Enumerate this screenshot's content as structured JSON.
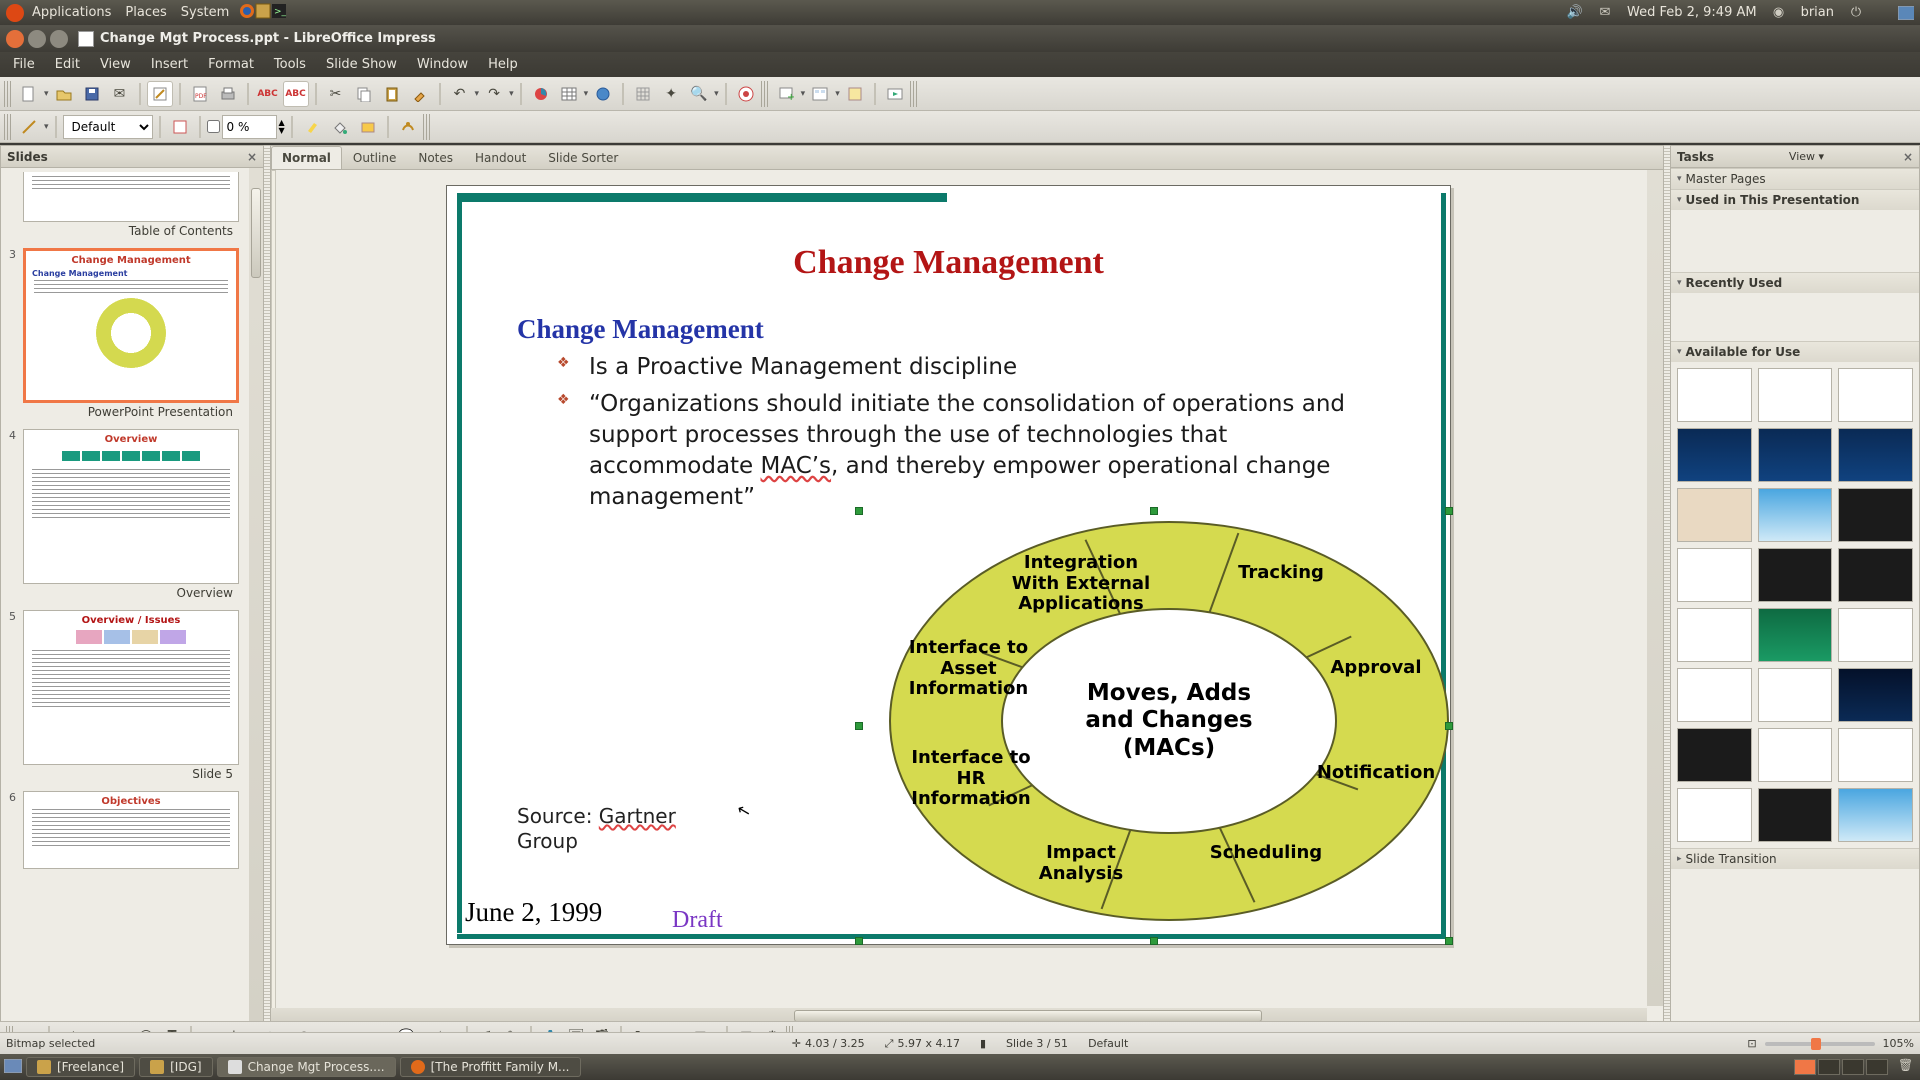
{
  "gnome": {
    "menus": [
      "Applications",
      "Places",
      "System"
    ],
    "datetime": "Wed Feb  2,  9:49 AM",
    "user": "brian"
  },
  "window": {
    "title": "Change Mgt Process.ppt - LibreOffice Impress"
  },
  "menubar": [
    "File",
    "Edit",
    "View",
    "Insert",
    "Format",
    "Tools",
    "Slide Show",
    "Window",
    "Help"
  ],
  "tb2": {
    "style": "Default",
    "pct": "0 %"
  },
  "slides_panel": {
    "title": "Slides"
  },
  "thumbs": [
    {
      "num": "",
      "cap": "Table of Contents",
      "half": true
    },
    {
      "num": "3",
      "cap": "PowerPoint Presentation",
      "sel": true,
      "type": "cm"
    },
    {
      "num": "4",
      "cap": "Overview",
      "type": "ov"
    },
    {
      "num": "5",
      "cap": "Slide 5",
      "type": "s5"
    },
    {
      "num": "6",
      "cap": "",
      "type": "obj",
      "half2": true
    }
  ],
  "viewtabs": [
    "Normal",
    "Outline",
    "Notes",
    "Handout",
    "Slide Sorter"
  ],
  "slide": {
    "title": "Change Management",
    "heading": "Change Management",
    "b1": "Is a Proactive Management discipline",
    "b2a": "“Organizations should initiate the consolidation of operations and support processes through the use of technologies that accommodate ",
    "b2mac": "MAC’s",
    "b2b": ", and thereby empower operational change management”",
    "sourceA": "Source: ",
    "sourceB": "Gartner",
    "sourceC": "Group",
    "date": "June 2, 1999",
    "draft": "Draft",
    "center1": "Moves, Adds",
    "center2": "and Changes",
    "center3": "(MACs)",
    "segs": [
      "Integration With External Applications",
      "Tracking",
      "Approval",
      "Notification",
      "Scheduling",
      "Impact Analysis",
      "Interface to HR Information",
      "Interface to Asset Information"
    ]
  },
  "tasks": {
    "title": "Tasks",
    "view": "View",
    "s1": "Master Pages",
    "s2": "Used in This Presentation",
    "s3": "Recently Used",
    "s4": "Available for Use",
    "s5": "Slide Transition"
  },
  "status": {
    "sel": "Bitmap selected",
    "pos": "4.03 / 3.25",
    "size": "5.97 x 4.17",
    "slide": "Slide 3 / 51",
    "master": "Default",
    "zoom": "105%"
  },
  "bottom": {
    "tasks": [
      "[Freelance]",
      "[IDG]",
      "Change Mgt Process....",
      "[The Proffitt Family M..."
    ]
  }
}
